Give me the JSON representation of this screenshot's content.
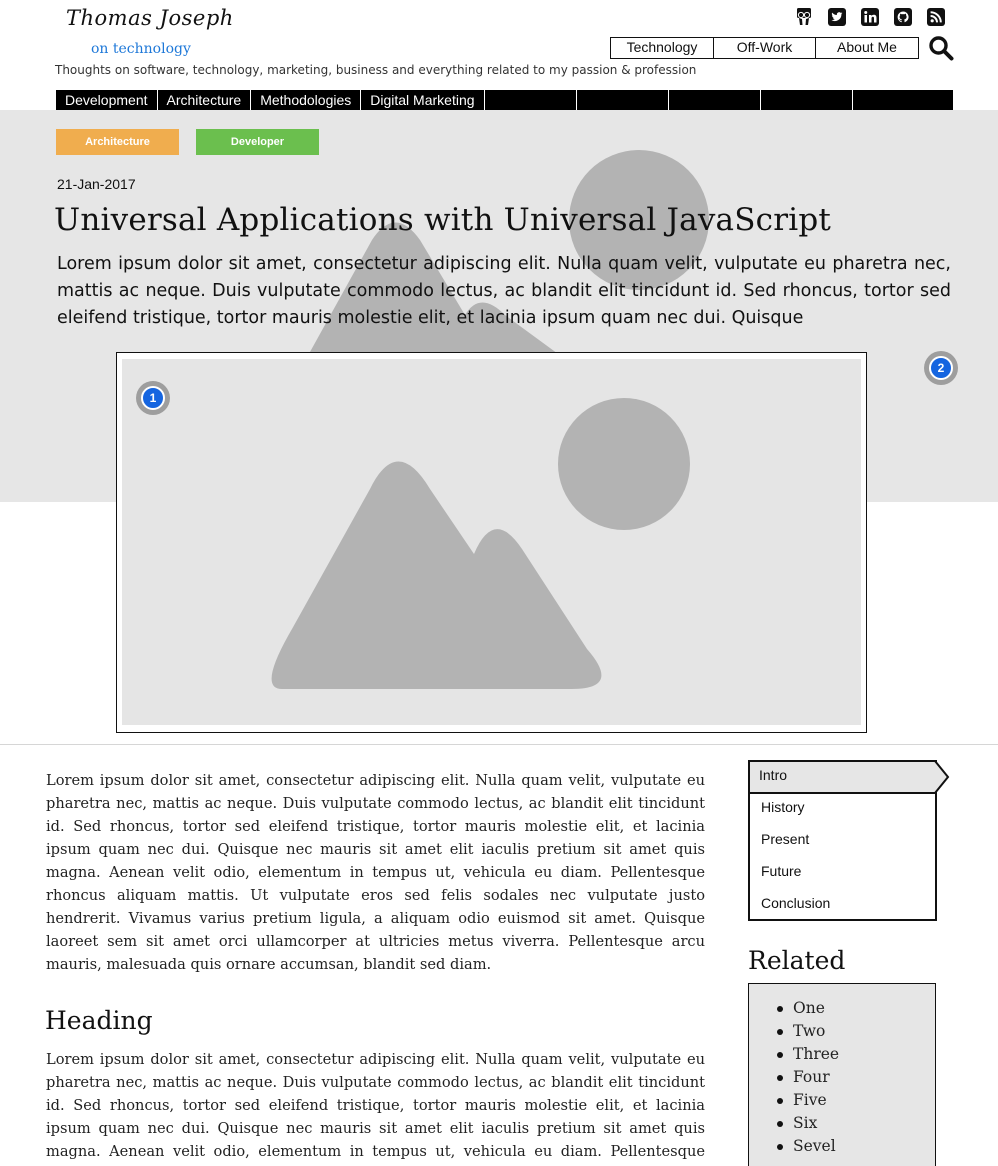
{
  "brand": {
    "name": "Thomas Joseph",
    "subtitle": "on technology",
    "tagline": "Thoughts on software, technology, marketing, business and everything related to my passion & profession"
  },
  "social_icons": [
    "slideshare-icon",
    "twitter-icon",
    "linkedin-icon",
    "github-icon",
    "rss-icon"
  ],
  "top_nav": [
    {
      "label": "Technology"
    },
    {
      "label": "Off-Work"
    },
    {
      "label": "About Me"
    }
  ],
  "category_nav": [
    {
      "label": "Development"
    },
    {
      "label": "Architecture"
    },
    {
      "label": "Methodologies"
    },
    {
      "label": "Digital Marketing"
    }
  ],
  "post": {
    "tags": [
      "Architecture",
      "Developer"
    ],
    "date": "21-Jan-2017",
    "title": "Universal Applications with Universal JavaScript",
    "lead": "Lorem ipsum dolor sit amet, consectetur adipiscing elit. Nulla quam velit, vulputate eu pharetra nec, mattis ac neque. Duis vulputate commodo lectus, ac blandit elit tincidunt id. Sed rhoncus, tortor sed eleifend tristique, tortor mauris molestie elit, et lacinia ipsum quam nec dui. Quisque",
    "badges": [
      "1",
      "2"
    ],
    "paragraph_1": "Lorem ipsum dolor sit amet, consectetur adipiscing elit. Nulla quam velit, vulputate eu pharetra nec, mattis ac neque. Duis vulputate commodo lectus, ac blandit elit tincidunt id. Sed rhoncus, tortor sed eleifend tristique, tortor mauris molestie elit, et lacinia ipsum quam nec dui. Quisque nec mauris sit amet elit iaculis pretium sit amet quis magna. Aenean velit odio, elementum in tempus ut, vehicula eu diam. Pellentesque rhoncus aliquam mattis. Ut vulputate eros sed felis sodales nec vulputate justo hendrerit. Vivamus varius pretium ligula, a aliquam odio euismod sit amet. Quisque laoreet sem sit amet orci ullamcorper at ultricies metus viverra. Pellentesque arcu mauris, malesuada quis ornare accumsan, blandit sed diam.",
    "heading": "Heading",
    "paragraph_2": "Lorem ipsum dolor sit amet, consectetur adipiscing elit. Nulla quam velit, vulputate eu pharetra nec, mattis ac neque. Duis vulputate commodo lectus, ac blandit elit tincidunt id. Sed rhoncus, tortor sed eleifend tristique, tortor mauris molestie elit, et lacinia ipsum quam nec dui. Quisque nec mauris sit amet elit iaculis pretium sit amet quis magna. Aenean velit odio, elementum in tempus ut, vehicula eu diam. Pellentesque rhoncus aliquam mattis. Ut"
  },
  "toc": {
    "active": "Intro",
    "items": [
      "History",
      "Present",
      "Future",
      "Conclusion"
    ]
  },
  "related": {
    "title": "Related",
    "items": [
      "One",
      "Two",
      "Three",
      "Four",
      "Five",
      "Six",
      "Sevel"
    ]
  },
  "colors": {
    "tag_architecture": "#f0ad4e",
    "tag_developer": "#6bbf4e",
    "badge_blue": "#1565e0",
    "link_blue": "#1e78d8"
  }
}
